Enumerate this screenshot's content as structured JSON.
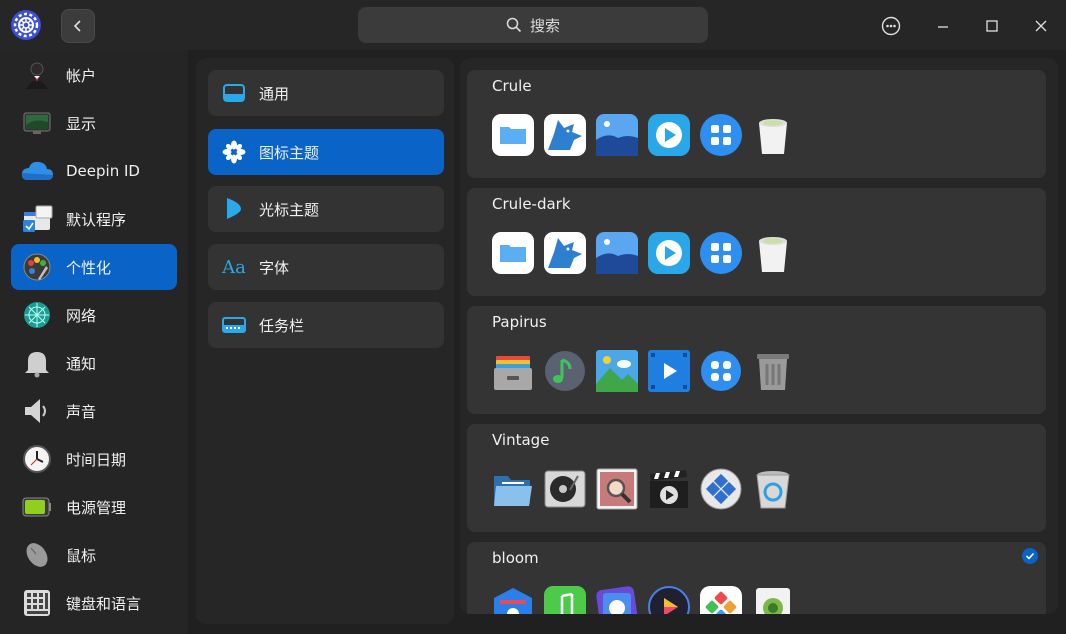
{
  "window": {
    "search_placeholder": "搜索"
  },
  "nav": {
    "items": [
      {
        "label": "帐户",
        "icon": "account-icon"
      },
      {
        "label": "显示",
        "icon": "display-icon"
      },
      {
        "label": "Deepin ID",
        "icon": "cloud-icon"
      },
      {
        "label": "默认程序",
        "icon": "default-apps-icon"
      },
      {
        "label": "个性化",
        "icon": "personalization-icon"
      },
      {
        "label": "网络",
        "icon": "network-icon"
      },
      {
        "label": "通知",
        "icon": "bell-icon"
      },
      {
        "label": "声音",
        "icon": "speaker-icon"
      },
      {
        "label": "时间日期",
        "icon": "clock-icon"
      },
      {
        "label": "电源管理",
        "icon": "battery-icon"
      },
      {
        "label": "鼠标",
        "icon": "mouse-icon"
      },
      {
        "label": "键盘和语言",
        "icon": "keyboard-icon"
      }
    ],
    "active": "个性化"
  },
  "submenu": {
    "items": [
      {
        "label": "通用",
        "icon": "general-icon"
      },
      {
        "label": "图标主题",
        "icon": "icon-theme-icon"
      },
      {
        "label": "光标主题",
        "icon": "cursor-theme-icon"
      },
      {
        "label": "字体",
        "icon": "font-icon"
      },
      {
        "label": "任务栏",
        "icon": "taskbar-icon"
      }
    ],
    "active": "图标主题",
    "font_icon_glyph": "Aa"
  },
  "themes": [
    {
      "name": "Crule"
    },
    {
      "name": "Crule-dark"
    },
    {
      "name": "Papirus"
    },
    {
      "name": "Vintage"
    },
    {
      "name": "bloom",
      "selected": true
    }
  ],
  "colors": {
    "accent": "#0a64c8",
    "background": "#202020",
    "panel": "#262626",
    "card": "#343434"
  }
}
